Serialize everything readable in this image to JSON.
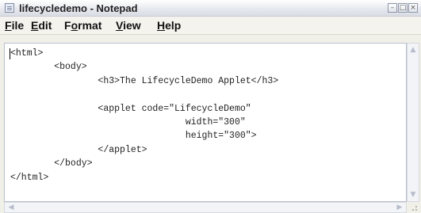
{
  "window": {
    "title": "lifecycledemo - Notepad",
    "caption_buttons": {
      "minimize": "–",
      "maximize": "□",
      "close": "×"
    }
  },
  "menu": {
    "items": [
      {
        "label": "File",
        "mnemonic": "F",
        "rest": "ile"
      },
      {
        "label": "Edit",
        "mnemonic": "E",
        "rest": "dit"
      },
      {
        "label": "Format",
        "prefix": "F",
        "mnemonic": "o",
        "rest": "rmat"
      },
      {
        "label": "View",
        "mnemonic": "V",
        "rest": "iew"
      },
      {
        "label": "Help",
        "mnemonic": "H",
        "rest": "elp"
      }
    ]
  },
  "editor": {
    "text": "<html>\n        <body>\n                <h3>The LifecycleDemo Applet</h3>\n\n                <applet code=\"LifecycleDemo\"\n                                width=\"300\"\n                                height=\"300\">\n                </applet>\n        </body>\n</html>"
  },
  "scrollbars": {
    "up": "▲",
    "down": "▼",
    "left": "◀",
    "right": "▶"
  }
}
